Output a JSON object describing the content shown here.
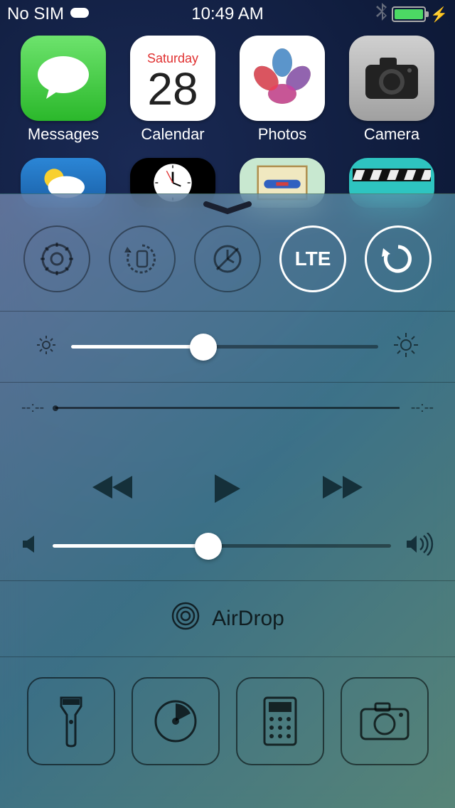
{
  "status": {
    "carrier": "No SIM",
    "time": "10:49 AM"
  },
  "apps": {
    "messages": "Messages",
    "calendar": "Calendar",
    "calendar_day": "Saturday",
    "calendar_date": "28",
    "photos": "Photos",
    "camera": "Camera"
  },
  "control_center": {
    "lte_label": "LTE",
    "scrubber_start": "--:--",
    "scrubber_end": "--:--",
    "brightness_percent": 43,
    "volume_percent": 46,
    "airdrop_label": "AirDrop",
    "toggles": {
      "settings_active": false,
      "rotation_active": false,
      "dnd_active": false,
      "lte_active": true,
      "refresh_active": true
    }
  }
}
